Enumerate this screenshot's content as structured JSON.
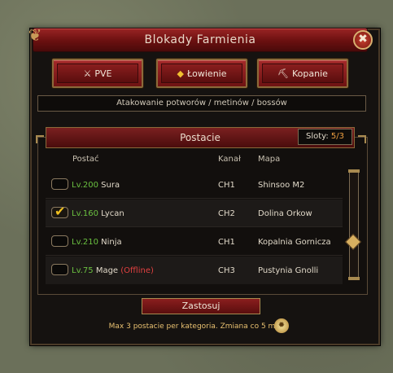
{
  "window": {
    "title": "Blokady Farmienia",
    "close_label": "✖"
  },
  "tabs": [
    {
      "label": "PVE",
      "icon": "sword-icon",
      "glyph": "⚔"
    },
    {
      "label": "Łowienie",
      "icon": "fish-icon",
      "glyph": "◆"
    },
    {
      "label": "Kopanie",
      "icon": "pickaxe-icon",
      "glyph": "⛏"
    }
  ],
  "description": "Atakowanie potworów / metinów / bossów",
  "section": {
    "title": "Postacie",
    "slots_label": "Sloty: ",
    "slots_value": "5/3"
  },
  "table": {
    "headers": {
      "character": "Postać",
      "channel": "Kanał",
      "map": "Mapa"
    },
    "rows": [
      {
        "checked": false,
        "level": "Lv.200",
        "name": "Sura",
        "status": "",
        "channel": "CH1",
        "map": "Shinsoo M2"
      },
      {
        "checked": true,
        "level": "Lv.160",
        "name": "Lycan",
        "status": "",
        "channel": "CH2",
        "map": "Dolina Orkow"
      },
      {
        "checked": false,
        "level": "Lv.210",
        "name": "Ninja",
        "status": "",
        "channel": "CH1",
        "map": "Kopalnia Gornicza"
      },
      {
        "checked": false,
        "level": "Lv.75",
        "name": "Mage",
        "status": "(Offline)",
        "channel": "CH3",
        "map": "Pustynia Gnolli"
      }
    ]
  },
  "apply_label": "Zastosuj",
  "footer_text": "Max 3 postacie per kategoria. Zmiana co 5 min.",
  "colors": {
    "accent_red": "#8a1e1e",
    "gold": "#a88a50",
    "level_green": "#6ac040",
    "offline_red": "#e04040"
  }
}
